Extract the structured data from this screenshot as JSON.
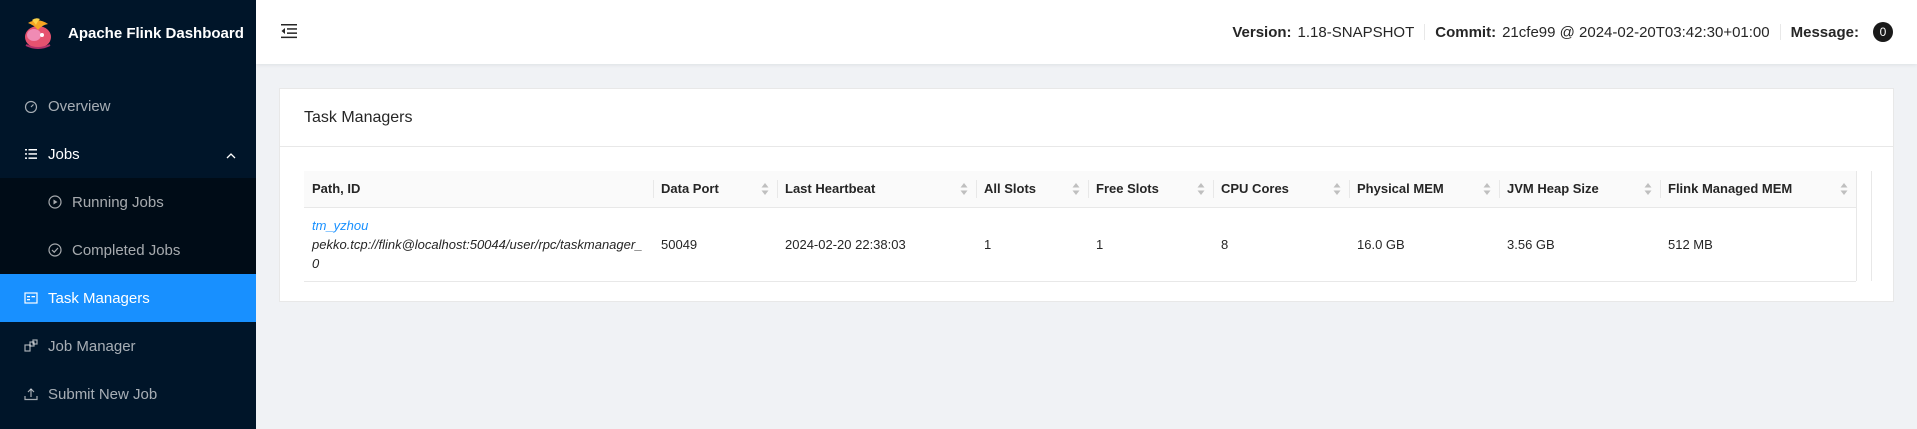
{
  "app": {
    "title": "Apache Flink Dashboard"
  },
  "sidebar": {
    "items": [
      {
        "label": "Overview",
        "icon": "dashboard-icon"
      },
      {
        "label": "Jobs",
        "icon": "list-icon"
      },
      {
        "label": "Running Jobs",
        "icon": "play-circle-icon"
      },
      {
        "label": "Completed Jobs",
        "icon": "check-circle-icon"
      },
      {
        "label": "Task Managers",
        "icon": "schedule-icon"
      },
      {
        "label": "Job Manager",
        "icon": "build-icon"
      },
      {
        "label": "Submit New Job",
        "icon": "upload-icon"
      }
    ],
    "active": "Task Managers"
  },
  "header": {
    "version_label": "Version:",
    "version_value": "1.18-SNAPSHOT",
    "commit_label": "Commit:",
    "commit_value": "21cfe99 @ 2024-02-20T03:42:30+01:00",
    "message_label": "Message:",
    "message_count": "0"
  },
  "card": {
    "title": "Task Managers"
  },
  "table": {
    "columns": [
      "Path, ID",
      "Data Port",
      "Last Heartbeat",
      "All Slots",
      "Free Slots",
      "CPU Cores",
      "Physical MEM",
      "JVM Heap Size",
      "Flink Managed MEM"
    ],
    "rows": [
      {
        "id": "tm_yzhou",
        "path_line1": "pekko.tcp://flink@localhost:50044/user/rpc/taskmanager_",
        "path_line2": "0",
        "data_port": "50049",
        "last_heartbeat": "2024-02-20 22:38:03",
        "all_slots": "1",
        "free_slots": "1",
        "cpu_cores": "8",
        "physical_mem": "16.0 GB",
        "jvm_heap": "3.56 GB",
        "flink_managed_mem": "512 MB"
      }
    ]
  },
  "colors": {
    "sidebar_bg": "#001529",
    "submenu_bg": "#000c17",
    "accent": "#1890ff"
  }
}
